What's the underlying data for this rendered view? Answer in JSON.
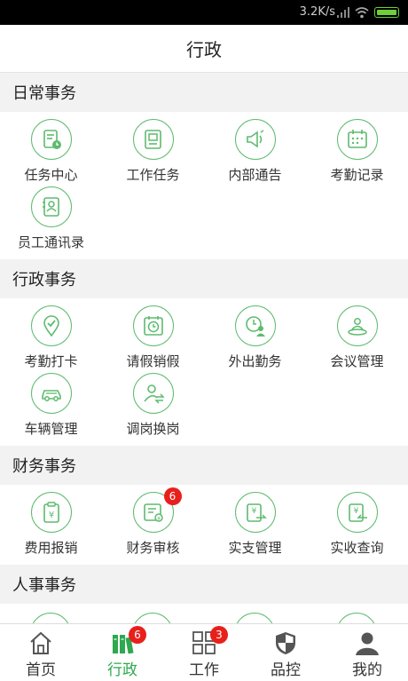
{
  "status_bar": {
    "speed": "3.2K/s"
  },
  "header": {
    "title": "行政"
  },
  "sections": [
    {
      "title": "日常事务",
      "items": [
        {
          "label": "任务中心",
          "icon": "task-center-icon"
        },
        {
          "label": "工作任务",
          "icon": "work-task-icon"
        },
        {
          "label": "内部通告",
          "icon": "megaphone-icon"
        },
        {
          "label": "考勤记录",
          "icon": "calendar-icon"
        },
        {
          "label": "员工通讯录",
          "icon": "contacts-book-icon"
        }
      ]
    },
    {
      "title": "行政事务",
      "items": [
        {
          "label": "考勤打卡",
          "icon": "location-check-icon"
        },
        {
          "label": "请假销假",
          "icon": "leave-clock-icon"
        },
        {
          "label": "外出勤务",
          "icon": "outing-clock-person-icon"
        },
        {
          "label": "会议管理",
          "icon": "meeting-people-icon"
        },
        {
          "label": "车辆管理",
          "icon": "car-icon"
        },
        {
          "label": "调岗换岗",
          "icon": "transfer-person-icon"
        }
      ]
    },
    {
      "title": "财务事务",
      "items": [
        {
          "label": "费用报销",
          "icon": "expense-clipboard-icon"
        },
        {
          "label": "财务审核",
          "icon": "finance-audit-icon",
          "badge": "6"
        },
        {
          "label": "实支管理",
          "icon": "payment-out-icon"
        },
        {
          "label": "实收查询",
          "icon": "payment-in-icon"
        }
      ]
    },
    {
      "title": "人事事务",
      "items": []
    }
  ],
  "tabbar": [
    {
      "label": "首页",
      "icon": "home-icon"
    },
    {
      "label": "行政",
      "icon": "admin-books-icon",
      "badge": "6",
      "active": true
    },
    {
      "label": "工作",
      "icon": "grid-icon",
      "badge": "3"
    },
    {
      "label": "品控",
      "icon": "shield-icon"
    },
    {
      "label": "我的",
      "icon": "user-icon"
    }
  ],
  "colors": {
    "accent": "#5dbb6e",
    "active_tab": "#2fa84f",
    "badge": "#e8201c"
  }
}
